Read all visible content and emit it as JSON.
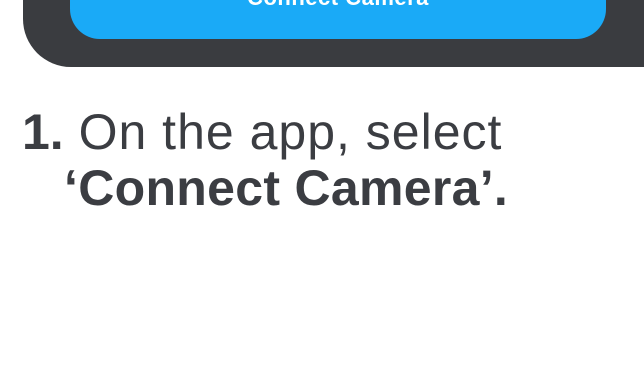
{
  "connect_button": {
    "label": "Connect Camera"
  },
  "instruction": {
    "step_number": "1.",
    "line_1": " On the app, select",
    "line_2": "‘Connect Camera’."
  },
  "colors": {
    "button_blue": "#1aaaf7",
    "phone_frame": "#3a3c40",
    "text_dark": "#3b3d42",
    "background": "#ffffff"
  }
}
